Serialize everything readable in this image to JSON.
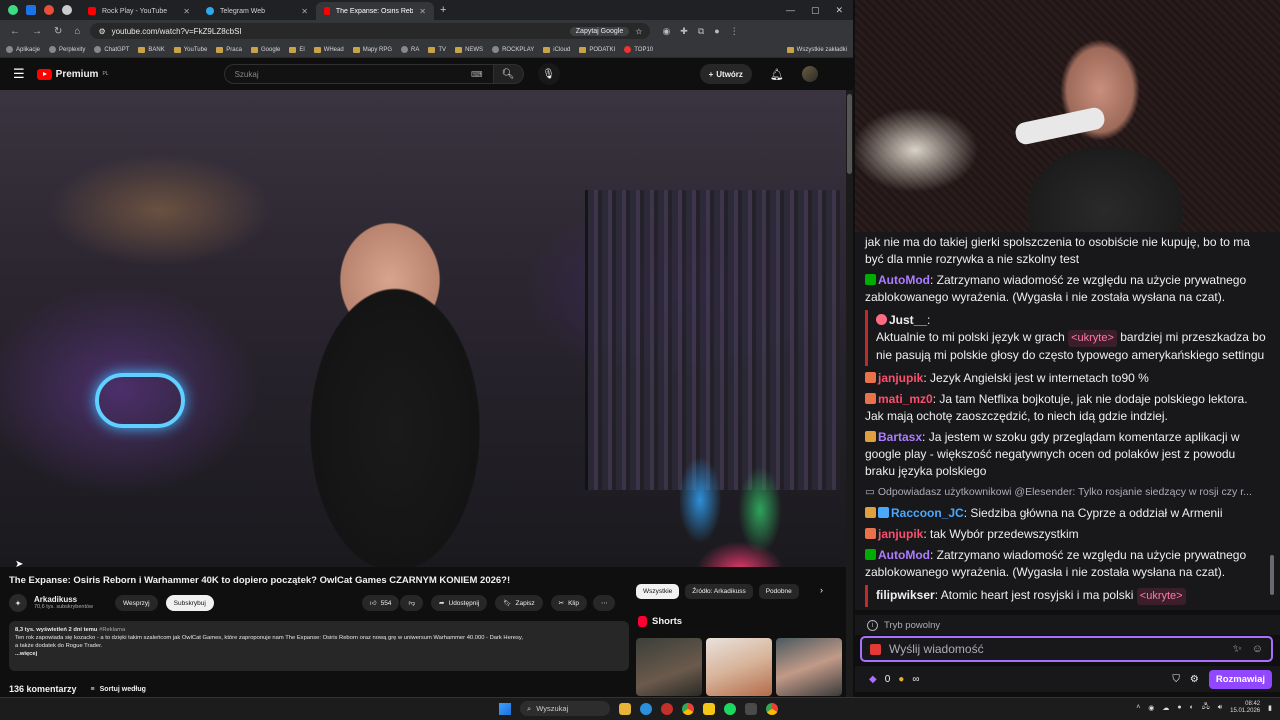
{
  "browser": {
    "tabs": [
      {
        "label": "Rock Play - YouTube",
        "active": false,
        "favicon_color": "#ff0000"
      },
      {
        "label": "Telegram Web",
        "active": false,
        "favicon_color": "#2aabee"
      },
      {
        "label": "The Expanse: Osiris Reborn i W...",
        "active": true,
        "favicon_color": "#ff0000"
      }
    ],
    "url": "youtube.com/watch?v=FkZ9LZ8cbSI",
    "google_button": "Zapytaj Google",
    "bookmarks": [
      "Aplikacje",
      "Perplexity",
      "ChatGPT",
      "BANK",
      "YouTube",
      "Praca",
      "Google",
      "El",
      "WHead",
      "Mapy RPG",
      "RA",
      "TV",
      "NEWS",
      "ROCKPLAY",
      "iCloud",
      "PODATKI",
      "TOP10"
    ],
    "bookmarks_all": "Wszystkie zakładki"
  },
  "youtube": {
    "logo": "Premium",
    "logo_sup": "PL",
    "search_placeholder": "Szukaj",
    "create_label": "Utwórz",
    "video": {
      "title": "The Expanse: Osiris Reborn i Warhammer 40K to dopiero początek? OwlCat Games CZARNYM KONIEM 2026?!",
      "channel": "Arkadikuss",
      "subscribers": "70,6 tys. subskrybentów",
      "support_label": "Wesprzyj",
      "subscribe_label": "Subskrybuj",
      "likes": "554",
      "share_label": "Udostępnij",
      "save_label": "Zapisz",
      "clip_label": "Klip",
      "more_label": "⋯"
    },
    "description": {
      "meta": "8,3 tys. wyświetleń  2 dni temu",
      "tag": "#Reklama",
      "line1": "Ten rok zapowiada się kozacko - a to dzięki takim szaleńcom jak OwlCat Games, które zaproponuje nam The Expanse: Osiris Reborn oraz nową grę w uniwersum Warhammer 40.000 - Dark Heresy,",
      "line2": "a także dodatek do Rogue Trader.",
      "more": "...więcej"
    },
    "comments_count": "136 komentarzy",
    "sort_label": "Sortuj według",
    "chips": [
      "Wszystkie",
      "Źródło: Arkadikuss",
      "Podobne"
    ],
    "shorts_label": "Shorts"
  },
  "chat": {
    "messages": [
      {
        "type": "text",
        "text": "jak nie ma do takiej gierki spolszczenia to osobiście nie kupuję, bo to ma być dla mnie rozrywka a nie szkolny test"
      },
      {
        "type": "mod",
        "user": "AutoMod",
        "text": "Zatrzymano wiadomość ze względu na użycie prywatnego zablokowanego wyrażenia. (Wygasła i nie została wysłana na czat)."
      },
      {
        "type": "boxed",
        "user": "Just__",
        "pre": "Aktualnie to mi polski język w grach",
        "hidden": "<ukryte>",
        "post": "bardziej mi przeszkadza bo nie pasują mi polskie głosy do często typowego amerykańskiego settingu"
      },
      {
        "type": "msg",
        "user": "janjupik",
        "color": "red",
        "text": "Jezyk Angielski jest w internetach to90 %"
      },
      {
        "type": "msg",
        "user": "mati_mz0",
        "color": "red",
        "text": "Ja tam Netflixa bojkotuje, jak nie dodaje polskiego lektora. Jak mają ochotę zaoszczędzić, to niech idą gdzie indziej."
      },
      {
        "type": "msg",
        "user": "Bartasx",
        "color": "mod",
        "text": "Ja jestem w szoku gdy przeglądam komentarze aplikacji w google play - większość negatywnych ocen od polaków jest z powodu braku języka polskiego"
      },
      {
        "type": "reply",
        "text": "Odpowiadasz użytkownikowi @Elesender: Tylko rosjanie siedzący w rosji czy r..."
      },
      {
        "type": "msg",
        "user": "Raccoon_JC",
        "color": "blue",
        "text": "Siedziba główna na Cyprze a oddział w Armenii"
      },
      {
        "type": "msg",
        "user": "janjupik",
        "color": "red",
        "text": "tak Wybór przedewszystkim"
      },
      {
        "type": "mod",
        "user": "AutoMod",
        "text": "Zatrzymano wiadomość ze względu na użycie prywatnego zablokowanego wyrażenia. (Wygasła i nie została wysłana na czat)."
      },
      {
        "type": "boxed-inline",
        "user": "filipwikser",
        "text": "Atomic heart jest rosyjski i ma polski",
        "hidden": "<ukryte>"
      }
    ],
    "slow_mode": "Tryb powolny",
    "input_placeholder": "Wyślij wiadomość",
    "points": "0",
    "infinity": "∞",
    "chat_button": "Rozmawiaj"
  },
  "taskbar": {
    "search_placeholder": "Wyszukaj",
    "time": "08:42",
    "date": "15.01.2026"
  }
}
